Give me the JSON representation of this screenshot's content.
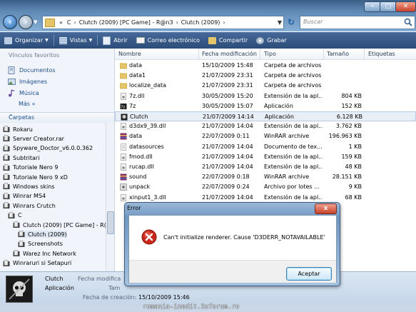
{
  "address": {
    "crumbs": [
      "«",
      "C",
      "Clutch (2009) [PC Game] - R@n3",
      "Clutch (2009)"
    ],
    "separator": "›",
    "search_placeholder": "Buscar"
  },
  "toolbar": {
    "organize": "Organizar",
    "views": "Vistas",
    "open": "Abrir",
    "email": "Correo electrónico",
    "share": "Compartir",
    "burn": "Grabar"
  },
  "nav": {
    "favorites_header": "Vínculos favoritos",
    "favorites": [
      "Documentos",
      "Imágenes",
      "Música"
    ],
    "more": "Más",
    "more_arrow": "»",
    "folders_header": "Carpetas",
    "folders_arrow": "⌃",
    "tree": [
      {
        "label": "Rokaru"
      },
      {
        "label": "Server Creator.rar"
      },
      {
        "label": "Spyware_Doctor_v6.0.0.362"
      },
      {
        "label": "Subtritari"
      },
      {
        "label": "Tutoriale Nero 9"
      },
      {
        "label": "Tutoriale Nero 9 xD"
      },
      {
        "label": "Windows skins"
      },
      {
        "label": "Winrar MS4"
      },
      {
        "label": "Winrars Crutch"
      },
      {
        "label": "C"
      },
      {
        "label": "Clutch (2009) [PC Game] - R("
      },
      {
        "label": "Clutch (2009)"
      },
      {
        "label": "Screenshots"
      },
      {
        "label": "Warez Inc Network"
      },
      {
        "label": "Winraruri si Setapuri"
      }
    ]
  },
  "columns": {
    "name": "Nombre",
    "modified": "Fecha modificación",
    "type": "Tipo",
    "size": "Tamaño",
    "tags": "Etiquetas"
  },
  "files": [
    {
      "name": "data",
      "date": "15/10/2009 15:48",
      "type": "Carpeta de archivos",
      "size": "",
      "icon": "folder"
    },
    {
      "name": "data1",
      "date": "21/07/2009 23:31",
      "type": "Carpeta de archivos",
      "size": "",
      "icon": "folder"
    },
    {
      "name": "localize_data",
      "date": "21/07/2009 23:31",
      "type": "Carpeta de archivos",
      "size": "",
      "icon": "folder"
    },
    {
      "name": "7z.dll",
      "date": "30/05/2009 15:20",
      "type": "Extensión de la apl...",
      "size": "804 KB",
      "icon": "dll"
    },
    {
      "name": "7z",
      "date": "30/05/2009 15:07",
      "type": "Aplicación",
      "size": "152 KB",
      "icon": "exe"
    },
    {
      "name": "Clutch",
      "date": "21/07/2009 14:14",
      "type": "Aplicación",
      "size": "6.128 KB",
      "icon": "game"
    },
    {
      "name": "d3dx9_39.dll",
      "date": "21/07/2009 14:04",
      "type": "Extensión de la apl...",
      "size": "3.762 KB",
      "icon": "dll"
    },
    {
      "name": "data",
      "date": "22/07/2009 0:11",
      "type": "WinRAR archive",
      "size": "196.963 KB",
      "icon": "rar"
    },
    {
      "name": "datasources",
      "date": "21/07/2009 14:04",
      "type": "Documento de tex...",
      "size": "1 KB",
      "icon": "txt"
    },
    {
      "name": "fmod.dll",
      "date": "21/07/2009 14:04",
      "type": "Extensión de la apl...",
      "size": "159 KB",
      "icon": "dll"
    },
    {
      "name": "rucap.dll",
      "date": "21/07/2009 14:04",
      "type": "Extensión de la apl...",
      "size": "48 KB",
      "icon": "dll"
    },
    {
      "name": "sound",
      "date": "22/07/2009 0:18",
      "type": "WinRAR archive",
      "size": "28.151 KB",
      "icon": "rar"
    },
    {
      "name": "unpack",
      "date": "22/07/2009 0:24",
      "type": "Archivo por lotes ...",
      "size": "9 KB",
      "icon": "bat"
    },
    {
      "name": "xinput1_3.dll",
      "date": "21/07/2009 14:04",
      "type": "Extensión de la apl...",
      "size": "68 KB",
      "icon": "dll"
    }
  ],
  "details": {
    "name": "Clutch",
    "type": "Aplicación",
    "modified_label": "Fecha modifica",
    "size_label": "Tam",
    "created_label": "Fecha de creación:",
    "created_value": "15/10/2009 15:46"
  },
  "dialog": {
    "title": "Error",
    "close": "x",
    "message": "Can't initialize renderer. Cause 'D3DERR_NOTAVAILABLE'",
    "ok_button": "Aceptar"
  },
  "watermark": "romania-inedit.3xforum.ro",
  "colors": {
    "folder": "#e5c56a",
    "accent": "#2c4c78",
    "error": "#c8281c"
  }
}
